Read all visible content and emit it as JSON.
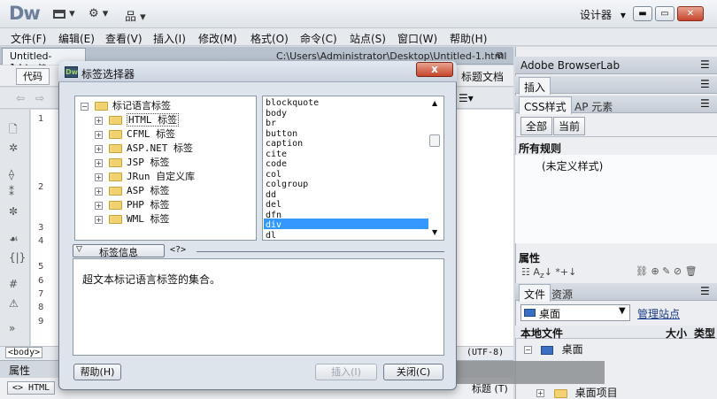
{
  "app": {
    "logo": "Dw",
    "layout_menu": "▾",
    "settings_menu": "⚙ ▾",
    "sites_menu": "品 ▾",
    "workspace": "设计器",
    "workspace_arrow": "▾"
  },
  "menus": [
    "文件(F)",
    "编辑(E)",
    "查看(V)",
    "插入(I)",
    "修改(M)",
    "格式(O)",
    "命令(C)",
    "站点(S)",
    "窗口(W)",
    "帮助(H)"
  ],
  "document": {
    "tab": "Untitled-1.html*",
    "path": "C:\\Users\\Administrator\\Desktop\\Untitled-1.html",
    "code_button": "代码",
    "title_label": "标题文档",
    "line_numbers": [
      "1",
      "2",
      "3",
      "4",
      "5",
      "6",
      "7",
      "8",
      "9"
    ],
    "tag_selector": "<body>",
    "encoding": "(UTF-8)",
    "properties_tab": "属性",
    "html_button": "<> HTML",
    "title_field_label": "标题 (T)"
  },
  "dialog": {
    "title": "标签选择器",
    "close": "x",
    "tree": [
      {
        "label": "标记语言标签",
        "expander": "−",
        "level": 0
      },
      {
        "label": "HTML 标签",
        "expander": "+",
        "level": 1
      },
      {
        "label": "CFML 标签",
        "expander": "+",
        "level": 1
      },
      {
        "label": "ASP.NET 标签",
        "expander": "+",
        "level": 1
      },
      {
        "label": "JSP 标签",
        "expander": "+",
        "level": 1
      },
      {
        "label": "JRun 自定义库",
        "expander": "+",
        "level": 1
      },
      {
        "label": "ASP 标签",
        "expander": "+",
        "level": 1
      },
      {
        "label": "PHP 标签",
        "expander": "+",
        "level": 1
      },
      {
        "label": "WML 标签",
        "expander": "+",
        "level": 1
      }
    ],
    "tags": [
      "blockquote",
      "body",
      "br",
      "button",
      "caption",
      "cite",
      "code",
      "col",
      "colgroup",
      "dd",
      "del",
      "dfn",
      "div",
      "dl"
    ],
    "selected_tag": "div",
    "info_label": "标签信息",
    "info_icon": "<?>",
    "info_text": "超文本标记语言标签的集合。",
    "help_button": "帮助(H)",
    "insert_button": "插入(I)",
    "close_button": "关闭(C)"
  },
  "right": {
    "browserlab": "Adobe BrowserLab",
    "insert": "插入",
    "css_tab": "CSS样式",
    "ap_tab": "AP 元素",
    "all_btn": "全部",
    "current_btn": "当前",
    "all_rules": "所有规则",
    "undefined_style": "(未定义样式)",
    "properties": "属性",
    "files_tab": "文件",
    "assets_tab": "资源",
    "location": "桌面",
    "manage_sites": "管理站点",
    "col_local": "本地文件",
    "col_size": "大小",
    "col_type": "类型",
    "tree_root": "桌面",
    "tree_item": "桌面项目"
  }
}
